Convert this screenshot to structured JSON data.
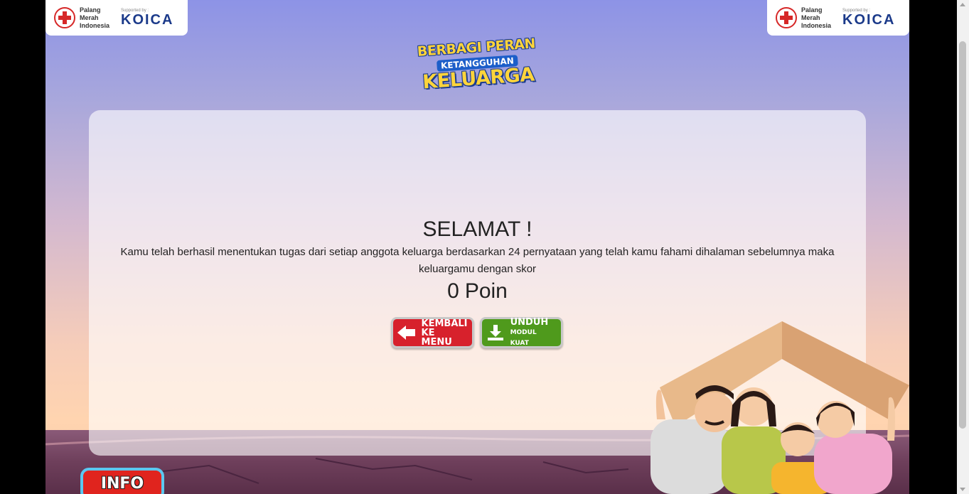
{
  "sponsors": {
    "pmi_text": "Palang Merah Indonesia",
    "supported_by": "Supported by :",
    "koica": "KOICA"
  },
  "logo": {
    "line1": "BERBAGI PERAN",
    "line2": "KETANGGUHAN",
    "line3": "KELUARGA"
  },
  "result": {
    "title": "SELAMAT !",
    "message": "Kamu telah berhasil menentukan tugas dari setiap anggota keluarga berdasarkan 24 pernyataan yang telah kamu fahami dihalaman sebelumnya maka keluargamu dengan skor",
    "score_value": "0",
    "score_unit": "Poin"
  },
  "buttons": {
    "back_line1": "KEMBALI",
    "back_line2": "KE MENU",
    "download_line1": "UNDUH",
    "download_line2": "MODUL KUAT",
    "info": "INFO"
  },
  "icons": {
    "back": "arrow-left-icon",
    "download": "download-icon",
    "pmi": "red-cross-icon"
  },
  "colors": {
    "back_button": "#d7212c",
    "download_button": "#4f9a1c",
    "info_button": "#e0241e",
    "logo_yellow": "#ffd43b"
  }
}
